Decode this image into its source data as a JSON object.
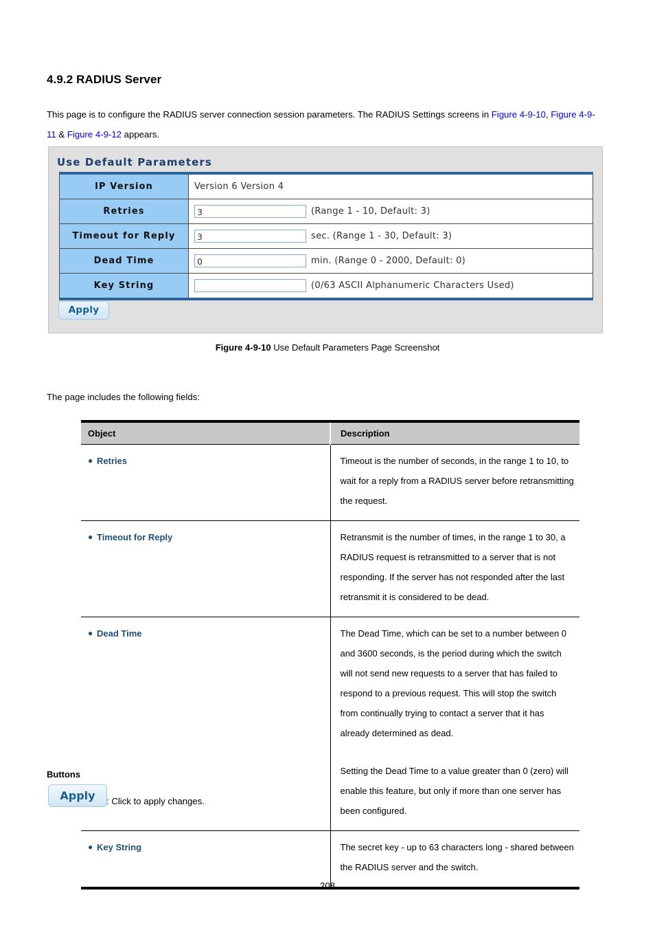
{
  "heading": "4.9.2 RADIUS Server",
  "intro": {
    "part1": "This page is to configure the RADIUS server connection session parameters. The RADIUS Settings screens in ",
    "link1": "Figure 4-9-10",
    "part2": ", ",
    "link2": "Figure 4-9-11",
    "part3": " & ",
    "link3": "Figure 4-9-12",
    "part4": " appears."
  },
  "panel": {
    "title": "Use Default Parameters",
    "rows": [
      {
        "label": "IP Version",
        "value": "Version 6 Version 4",
        "input": null,
        "hint": null
      },
      {
        "label": "Retries",
        "value": null,
        "input": "3",
        "hint": "(Range 1 - 10, Default: 3)"
      },
      {
        "label": "Timeout for Reply",
        "value": null,
        "input": "3",
        "hint": "sec. (Range 1 - 30, Default: 3)"
      },
      {
        "label": "Dead Time",
        "value": null,
        "input": "0",
        "hint": "min. (Range 0 - 2000, Default: 0)"
      },
      {
        "label": "Key String",
        "value": null,
        "input": "",
        "hint": "(0/63 ASCII Alphanumeric Characters Used)"
      }
    ],
    "apply_label": "Apply"
  },
  "figure_caption": {
    "bold": "Figure 4-9-10",
    "rest": " Use Default Parameters Page Screenshot"
  },
  "lead": "The page includes the following fields:",
  "desc_table": {
    "headers": {
      "object": "Object",
      "description": "Description"
    },
    "rows": [
      {
        "object": "Retries",
        "paragraphs": [
          "Timeout is the number of seconds, in the range 1 to 10, to wait for a reply from a RADIUS server before retransmitting the request."
        ]
      },
      {
        "object": "Timeout for Reply",
        "paragraphs": [
          "Retransmit is the number of times, in the range 1 to 30, a RADIUS request is retransmitted to a server that is not responding. If the server has not responded after the last retransmit it is considered to be dead."
        ]
      },
      {
        "object": "Dead Time",
        "paragraphs": [
          "The Dead Time, which can be set to a number between 0 and 3600 seconds, is the period during which the switch will not send new requests to a server that has failed to respond to a previous request. This will stop the switch from continually trying to contact a server that it has already determined as dead.",
          "Setting the Dead Time to a value greater than 0 (zero) will enable this feature, but only if more than one server has been configured."
        ]
      },
      {
        "object": "Key String",
        "paragraphs": [
          "The secret key - up to 63 characters long - shared between the RADIUS server and the switch."
        ]
      }
    ]
  },
  "buttons_section": {
    "heading": "Buttons",
    "apply_label": "Apply",
    "apply_description": ": Click to apply changes."
  },
  "page_number": "208",
  "colors": {
    "link": "#0000ee",
    "panel_header_blue": "#2f6499",
    "label_cell_blue": "#99ccf5",
    "object_text": "#1f4e79",
    "table_header_gray": "#c8c8c8"
  }
}
